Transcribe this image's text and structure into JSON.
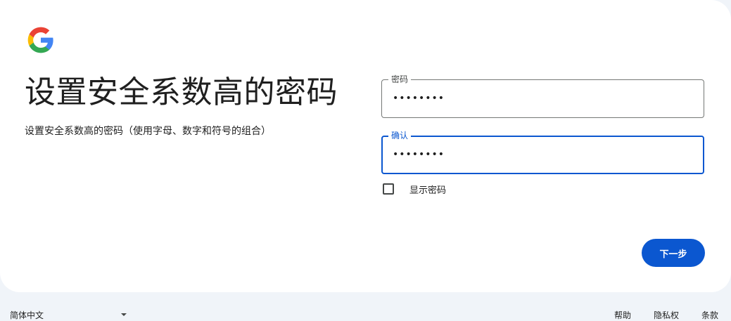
{
  "card": {
    "headline": "设置安全系数高的密码",
    "subtext": "设置安全系数高的密码（使用字母、数字和符号的组合）"
  },
  "form": {
    "password": {
      "label": "密码",
      "value": "••••••••"
    },
    "confirm": {
      "label": "确认",
      "value": "••••••••"
    },
    "show_password": {
      "label": "显示密码",
      "checked": false
    },
    "next_label": "下一步"
  },
  "footer": {
    "language": "简体中文",
    "links": {
      "help": "帮助",
      "privacy": "隐私权",
      "terms": "条款"
    }
  },
  "colors": {
    "accent": "#0b57d0",
    "page_background": "#f0f4f9",
    "card_background": "#ffffff",
    "text": "#1f1f1f"
  },
  "icons": {
    "logo": "google-logo-icon",
    "language_dropdown": "caret-down-icon"
  }
}
